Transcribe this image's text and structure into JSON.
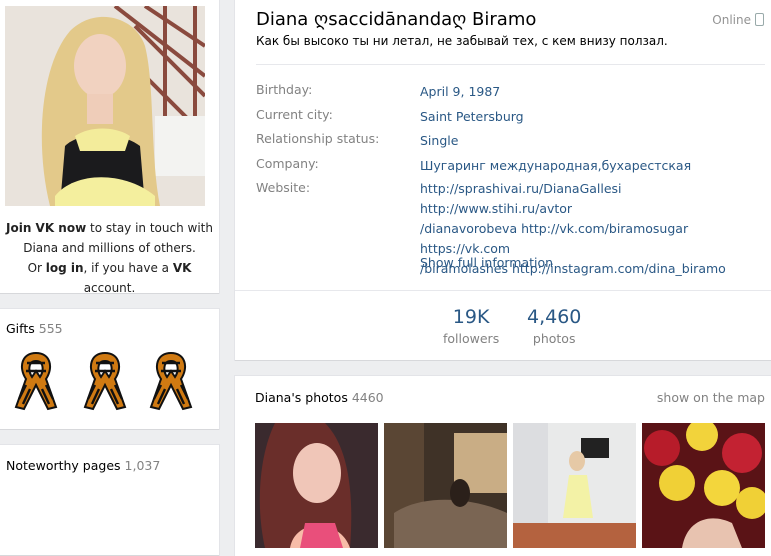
{
  "left": {
    "join_cta": "Join VK now",
    "join_text_1": " to stay in touch with",
    "join_text_2": "Diana and millions of others.",
    "join_or": "Or ",
    "login": "log in",
    "join_text_3": ", if you have a ",
    "vk": "VK",
    "join_text_4": " account."
  },
  "gifts": {
    "label": "Gifts",
    "count": "555",
    "icon": "st-george-ribbon-icon"
  },
  "noteworthy": {
    "label": "Noteworthy pages",
    "count": "1,037"
  },
  "profile": {
    "name": "Diana ღsaccidānandaღ Biramo",
    "status": "Как бы высоко ты ни летал, не забывай тех, с кем внизу ползал.",
    "online": "Online",
    "rows": [
      {
        "label": "Birthday:",
        "value": "April 9, 1987"
      },
      {
        "label": "Current city:",
        "value": "Saint Petersburg"
      },
      {
        "label": "Relationship status:",
        "value": "Single"
      },
      {
        "label": "Company:",
        "value": "Шугаринг международная,бухарестская"
      },
      {
        "label": "Website:",
        "value_lines": [
          "http://sprashivai.ru/DianaGallesi http://www.stihi.ru/avtor",
          "/dianavorobeva http://vk.com/biramosugar https://vk.com",
          "/biramolashes http://instagram.com/dina_biramo"
        ]
      }
    ],
    "show_full": "Show full information",
    "counters": [
      {
        "num": "19K",
        "label": "followers"
      },
      {
        "num": "4,460",
        "label": "photos"
      }
    ]
  },
  "photos": {
    "title": "Diana's photos",
    "count": "4460",
    "show_map": "show on the map"
  },
  "colors": {
    "link": "#2a5885",
    "muted": "#828282",
    "bg": "#edeef0"
  }
}
